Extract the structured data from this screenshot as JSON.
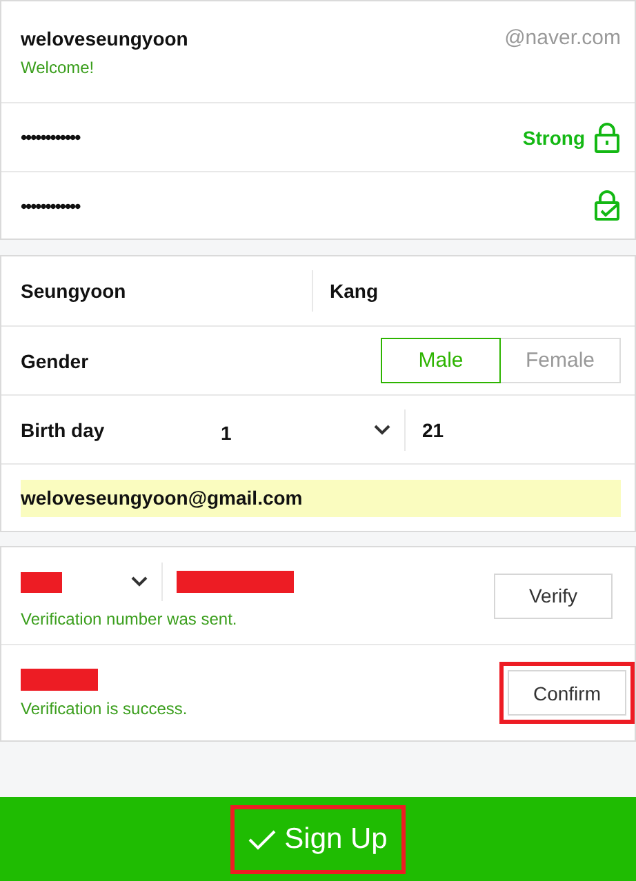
{
  "account": {
    "id": "weloveseungyoon",
    "domain": "@naver.com",
    "message": "Welcome!"
  },
  "password": {
    "value": "••••••••••••",
    "strength": "Strong"
  },
  "password_confirm": {
    "value": "••••••••••••",
    "matched": true
  },
  "profile": {
    "first_name": "Seungyoon",
    "last_name": "Kang",
    "gender_label": "Gender",
    "genders": [
      {
        "label": "Male",
        "selected": true
      },
      {
        "label": "Female",
        "selected": false
      }
    ],
    "birthday": {
      "label": "Birth day",
      "month": "1",
      "day": "21"
    },
    "email": "weloveseungyoon@gmail.com"
  },
  "phone": {
    "button": {
      "label": "Verify",
      "highlighted": false
    },
    "message": "Verification number was sent."
  },
  "code": {
    "button": {
      "label": "Confirm",
      "highlighted": true
    },
    "message": "Verification is success."
  },
  "submit": {
    "label": "Sign Up",
    "highlighted": true
  }
}
